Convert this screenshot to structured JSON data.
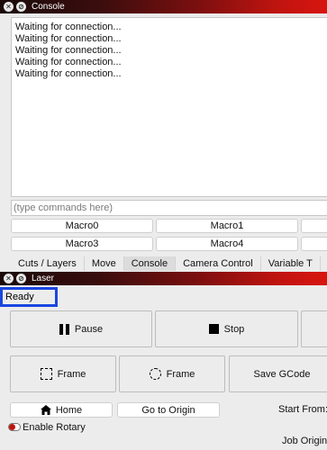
{
  "console_window": {
    "title": "Console",
    "close_glyph": "✕",
    "restore_glyph": "⊘",
    "lines": [
      "Waiting for connection...",
      "Waiting for connection...",
      "Waiting for connection...",
      "Waiting for connection...",
      "Waiting for connection..."
    ],
    "command_placeholder": "(type commands here)",
    "macros_row1": [
      "Macro0",
      "Macro1",
      ""
    ],
    "macros_row2": [
      "Macro3",
      "Macro4",
      ""
    ],
    "tabs": [
      "Cuts / Layers",
      "Move",
      "Console",
      "Camera Control",
      "Variable T"
    ],
    "active_tab": "Console"
  },
  "laser_window": {
    "title": "Laser",
    "close_glyph": "✕",
    "restore_glyph": "⊘",
    "status": "Ready",
    "pause_label": "Pause",
    "stop_label": "Stop",
    "frame_rect_label": "Frame",
    "frame_circle_label": "Frame",
    "save_gcode_label": "Save GCode",
    "home_label": "Home",
    "go_to_origin_label": "Go to Origin",
    "start_from_label": "Start From:",
    "enable_rotary_label": "Enable Rotary",
    "job_origin_label": "Job Origin",
    "icons": {
      "pause": "pause-icon",
      "stop": "stop-icon",
      "frame_rect": "frame-rect-icon",
      "frame_circle": "frame-circle-icon",
      "home": "home-icon"
    }
  }
}
